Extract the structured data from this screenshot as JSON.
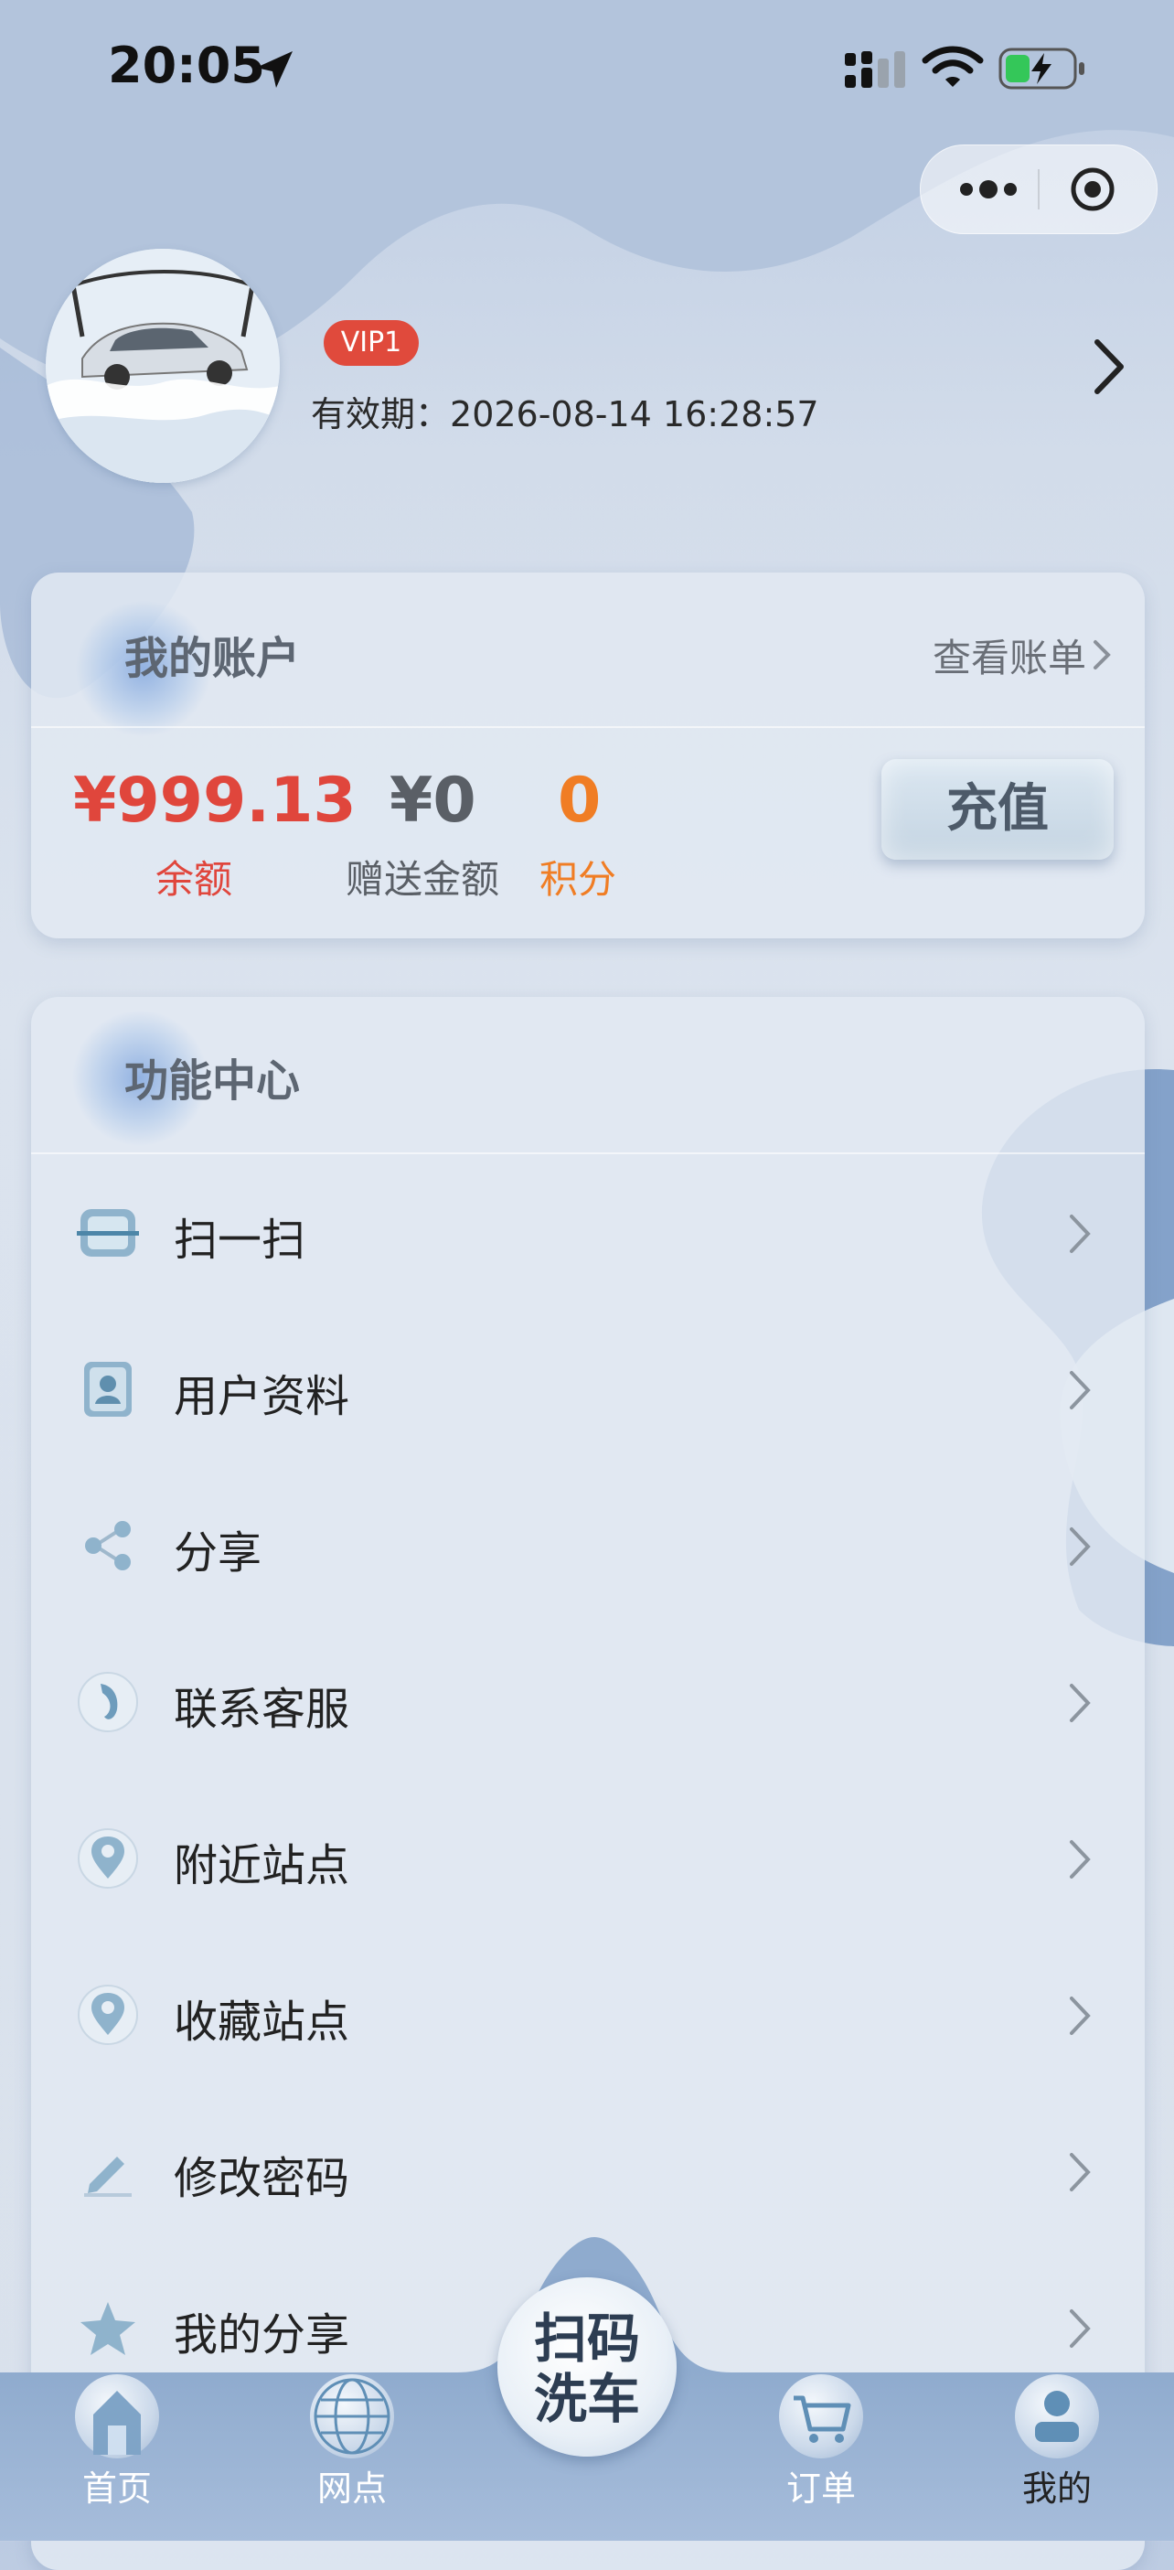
{
  "status_bar": {
    "time": "20:05"
  },
  "profile": {
    "vip_badge": "VIP1",
    "expiry_label": "有效期：",
    "expiry_value": "2026-08-14 16:28:57"
  },
  "account": {
    "title": "我的账户",
    "bill_link": "查看账单",
    "balance_value": "¥999.13",
    "balance_label": "余额",
    "gift_value": "¥0",
    "gift_label": "赠送金额",
    "points_value": "0",
    "points_label": "积分",
    "recharge_button": "充值",
    "colors": {
      "balance": "#e0463c",
      "gift": "#5a5f66",
      "points": "#f07d24"
    }
  },
  "functions": {
    "title": "功能中心",
    "items": [
      {
        "label": "扫一扫",
        "icon": "scan-icon"
      },
      {
        "label": "用户资料",
        "icon": "user-profile-icon"
      },
      {
        "label": "分享",
        "icon": "share-icon"
      },
      {
        "label": "联系客服",
        "icon": "customer-service-icon"
      },
      {
        "label": "附近站点",
        "icon": "location-pin-icon"
      },
      {
        "label": "收藏站点",
        "icon": "favorite-pin-icon"
      },
      {
        "label": "修改密码",
        "icon": "pencil-icon"
      },
      {
        "label": "我的分享",
        "icon": "star-icon"
      }
    ]
  },
  "tabbar": {
    "home": "首页",
    "outlets": "网点",
    "scan_line1": "扫码",
    "scan_line2": "洗车",
    "orders": "订单",
    "mine": "我的"
  }
}
